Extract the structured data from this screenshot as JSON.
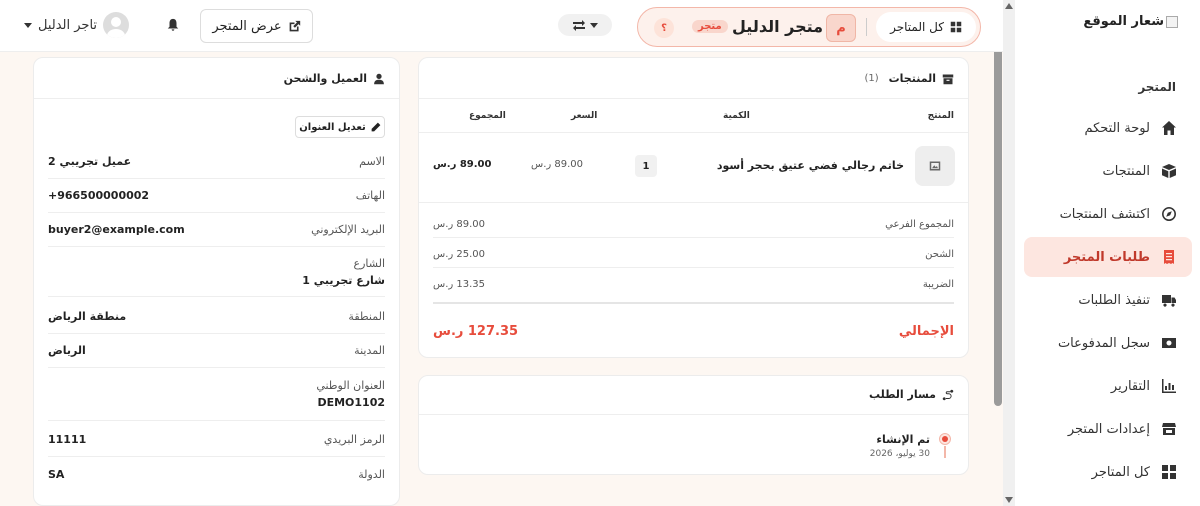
{
  "topbar": {
    "user_name": "تاجر الدليل",
    "view_store_label": "عرض المتجر",
    "store_name": "متجر الدليل",
    "store_badge": "متجر",
    "store_initial": "م",
    "help_mark": "؟",
    "all_stores_label": "كل المتاجر"
  },
  "sidebar": {
    "logo_text": "شعار الموقع",
    "section_title": "المتجر",
    "items": [
      {
        "label": "لوحة التحكم",
        "icon": "home-icon"
      },
      {
        "label": "المنتجات",
        "icon": "boxes-icon"
      },
      {
        "label": "اكتشف المنتجات",
        "icon": "compass-icon"
      },
      {
        "label": "طلبات المتجر",
        "icon": "receipt-icon",
        "active": true
      },
      {
        "label": "تنفيذ الطلبات",
        "icon": "truck-icon"
      },
      {
        "label": "سجل المدفوعات",
        "icon": "money-icon"
      },
      {
        "label": "التقارير",
        "icon": "chart-icon"
      },
      {
        "label": "إعدادات المتجر",
        "icon": "store-icon"
      },
      {
        "label": "كل المتاجر",
        "icon": "grid-icon"
      }
    ]
  },
  "customer": {
    "title": "العميل والشحن",
    "edit_address_label": "تعديل العنوان",
    "fields": [
      {
        "label": "الاسم",
        "value": "عميل تجريبي 2"
      },
      {
        "label": "الهاتف",
        "value": "+966500000002"
      },
      {
        "label": "البريد الإلكتروني",
        "value": "buyer2@example.com"
      },
      {
        "label": "الشارع",
        "value": "شارع تجريبي 1"
      },
      {
        "label": "المنطقة",
        "value": "منطقة الرياض"
      },
      {
        "label": "المدينة",
        "value": "الرياض"
      },
      {
        "label": "العنوان الوطني",
        "value": "DEMO1102"
      },
      {
        "label": "الرمز البريدي",
        "value": "11111"
      },
      {
        "label": "الدولة",
        "value": "SA"
      }
    ]
  },
  "products": {
    "title": "المنتجات",
    "count": "(1)",
    "columns": {
      "product": "المنتج",
      "quantity": "الكمية",
      "price": "السعر",
      "total": "المجموع"
    },
    "items": [
      {
        "name": "خاتم رجالي فضي عتيق بحجر أسود",
        "quantity": "1",
        "price": "89.00 ر.س",
        "total": "89.00 ر.س"
      }
    ],
    "summary": [
      {
        "label": "المجموع الفرعي",
        "value": "89.00 ر.س"
      },
      {
        "label": "الشحن",
        "value": "25.00 ر.س"
      },
      {
        "label": "الضريبة",
        "value": "13.35 ر.س"
      }
    ],
    "grand_total_label": "الإجمالي",
    "grand_total_value": "127.35 ر.س"
  },
  "order_path": {
    "title": "مسار الطلب",
    "events": [
      {
        "title": "تم الإنشاء",
        "date": "30 يوليو، 2026"
      }
    ]
  },
  "colors": {
    "accent": "#e74c3c",
    "accent_light": "#fde6e0",
    "background": "#fdf7f2"
  }
}
